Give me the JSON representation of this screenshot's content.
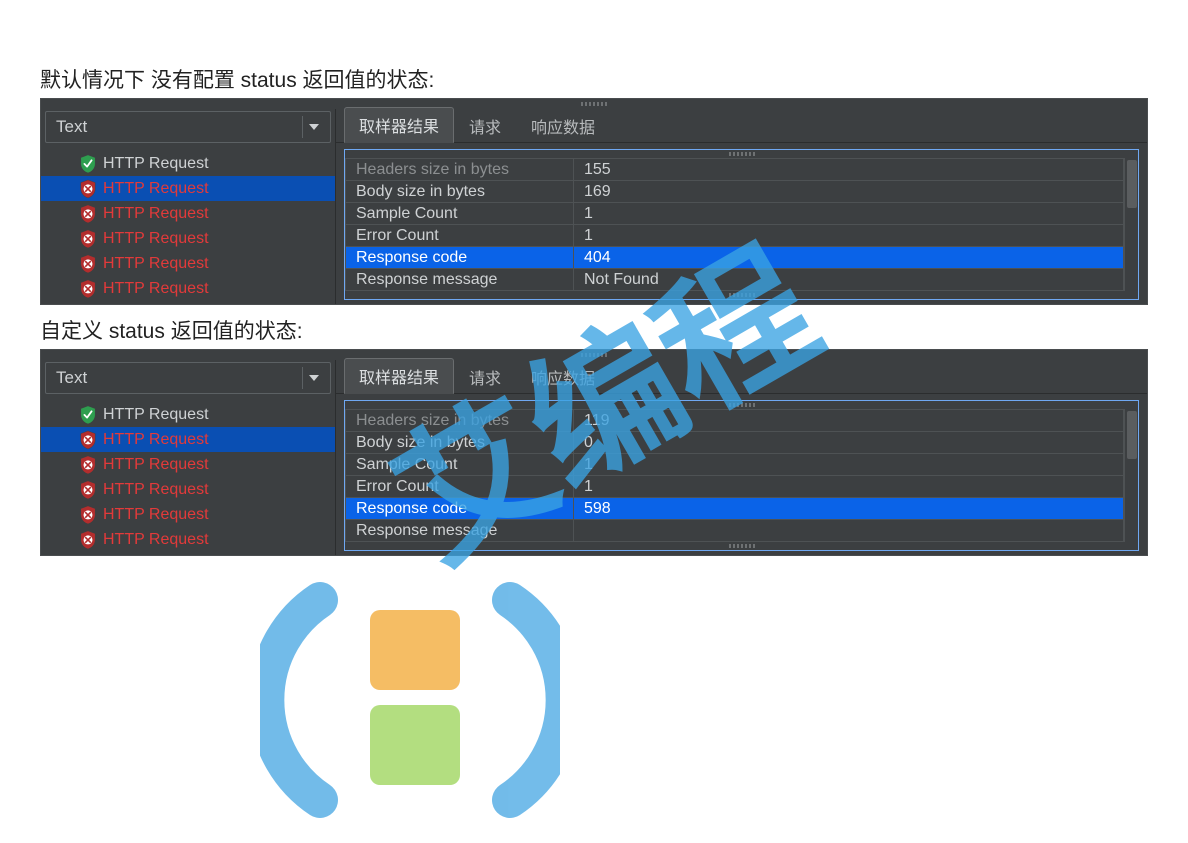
{
  "captions": {
    "default": "默认情况下 没有配置 status 返回值的状态:",
    "custom": "自定义 status 返回值的状态:"
  },
  "sidebar": {
    "dropdown_label": "Text",
    "items": [
      {
        "label": "HTTP Request",
        "status": "ok",
        "selected": false
      },
      {
        "label": "HTTP Request",
        "status": "err",
        "selected": true
      },
      {
        "label": "HTTP Request",
        "status": "err",
        "selected": false
      },
      {
        "label": "HTTP Request",
        "status": "err",
        "selected": false
      },
      {
        "label": "HTTP Request",
        "status": "err",
        "selected": false
      },
      {
        "label": "HTTP Request",
        "status": "err",
        "selected": false
      }
    ]
  },
  "tabs": [
    {
      "label": "取样器结果",
      "active": true
    },
    {
      "label": "请求",
      "active": false
    },
    {
      "label": "响应数据",
      "active": false
    }
  ],
  "panel1_rows": [
    {
      "k": "Headers size in bytes",
      "v": "155",
      "truncated": true
    },
    {
      "k": "Body size in bytes",
      "v": "169"
    },
    {
      "k": "Sample Count",
      "v": "1"
    },
    {
      "k": "Error Count",
      "v": "1"
    },
    {
      "k": "Response code",
      "v": "404",
      "highlight": true
    },
    {
      "k": "Response message",
      "v": "Not Found"
    }
  ],
  "panel2_rows": [
    {
      "k": "Headers size in bytes",
      "v": "119",
      "truncated": true
    },
    {
      "k": "Body size in bytes",
      "v": "0"
    },
    {
      "k": "Sample Count",
      "v": "1"
    },
    {
      "k": "Error Count",
      "v": "1"
    },
    {
      "k": "Response code",
      "v": "598",
      "highlight": true
    },
    {
      "k": "Response message",
      "v": ""
    }
  ],
  "watermark_text": "艾编程"
}
